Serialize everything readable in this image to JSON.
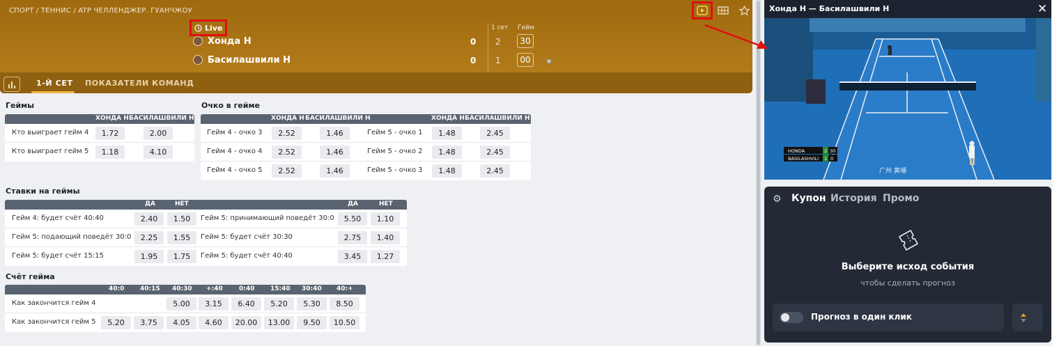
{
  "breadcrumb": "СПОРТ / ТЕННИС / ATP ЧЕЛЛЕНДЖЕР. ГУАНЧЖОУ",
  "header_icons": [
    "play-video-icon",
    "scoreboard-icon",
    "star-icon"
  ],
  "live_label": "Live",
  "scoreboard": {
    "col_set": "1 сет",
    "col_game": "Гейм",
    "players": [
      {
        "name": "Хонда Н",
        "sets": "0",
        "set1": "2",
        "game": "30"
      },
      {
        "name": "Басилашвили Н",
        "sets": "0",
        "set1": "1",
        "game": "00"
      }
    ]
  },
  "tabs": [
    {
      "label": "1-Й СЕТ",
      "active": true
    },
    {
      "label": "ПОКАЗАТЕЛИ КОМАНД",
      "active": false
    }
  ],
  "markets": {
    "games": {
      "title": "Геймы",
      "head": [
        "ХОНДА Н",
        "БАСИЛАШВИЛИ Н"
      ],
      "rows": [
        {
          "label": "Кто выиграет гейм 4",
          "odds": [
            "1.72",
            "2.00"
          ]
        },
        {
          "label": "Кто выиграет гейм 5",
          "odds": [
            "1.18",
            "4.10"
          ]
        }
      ]
    },
    "points": {
      "title": "Очко в гейме",
      "head": [
        "ХОНДА Н",
        "БАСИЛАШВИЛИ Н",
        "ХОНДА Н",
        "БАСИЛАШВИЛИ Н"
      ],
      "rows": [
        {
          "l1": "Гейм 4 - очко 3",
          "o1": [
            "2.52",
            "1.46"
          ],
          "l2": "Гейм 5 - очко 1",
          "o2": [
            "1.48",
            "2.45"
          ]
        },
        {
          "l1": "Гейм 4 - очко 4",
          "o1": [
            "2.52",
            "1.46"
          ],
          "l2": "Гейм 5 - очко 2",
          "o2": [
            "1.48",
            "2.45"
          ]
        },
        {
          "l1": "Гейм 4 - очко 5",
          "o1": [
            "2.52",
            "1.46"
          ],
          "l2": "Гейм 5 - очко 3",
          "o2": [
            "1.48",
            "2.45"
          ]
        }
      ]
    },
    "game_bets": {
      "title": "Ставки на геймы",
      "head": [
        "ДА",
        "НЕТ",
        "ДА",
        "НЕТ"
      ],
      "rows": [
        {
          "l1": "Гейм 4: будет счёт 40:40",
          "o1": [
            "2.40",
            "1.50"
          ],
          "l2": "Гейм 5: принимающий поведёт 30:0",
          "o2": [
            "5.50",
            "1.10"
          ]
        },
        {
          "l1": "Гейм 5: подающий поведёт 30:0",
          "o1": [
            "2.25",
            "1.55"
          ],
          "l2": "Гейм 5: будет счёт 30:30",
          "o2": [
            "2.75",
            "1.40"
          ]
        },
        {
          "l1": "Гейм 5: будет счёт 15:15",
          "o1": [
            "1.95",
            "1.75"
          ],
          "l2": "Гейм 5: будет счёт 40:40",
          "o2": [
            "3.45",
            "1.27"
          ]
        }
      ]
    },
    "game_score": {
      "title": "Счёт гейма",
      "head": [
        "40:0",
        "40:15",
        "40:30",
        "+:40",
        "0:40",
        "15:40",
        "30:40",
        "40:+"
      ],
      "rows": [
        {
          "label": "Как закончится гейм 4",
          "odds": [
            "",
            "",
            "5.00",
            "3.15",
            "6.40",
            "5.20",
            "5.30",
            "8.50"
          ]
        },
        {
          "label": "Как закончится гейм 5",
          "odds": [
            "5.20",
            "3.75",
            "4.05",
            "4.60",
            "20.00",
            "13.00",
            "9.50",
            "10.50"
          ]
        }
      ]
    }
  },
  "video": {
    "title": "Хонда Н — Басилашвили Н",
    "overlay_players": [
      "HONDA",
      "BASILASHVILI"
    ],
    "overlay_sets": [
      "2",
      "1"
    ],
    "overlay_points": [
      "30",
      "0"
    ],
    "overlay_caption": "广州   黄埔"
  },
  "coupon": {
    "tabs": [
      "Купон",
      "История",
      "Промо"
    ],
    "empty_title": "Выберите исход события",
    "empty_sub": "чтобы сделать прогноз",
    "oneclick_label": "Прогноз в один клик"
  },
  "colors": {
    "header": "#a8731a",
    "accent": "#f1b544",
    "highlight": "#e01010",
    "panel": "#232a36"
  }
}
